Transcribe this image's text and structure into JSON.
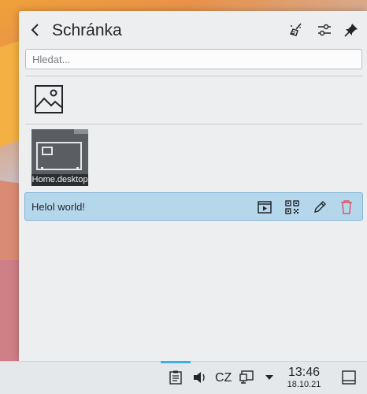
{
  "popup": {
    "title": "Schránka",
    "search_placeholder": "Hledat..."
  },
  "items": {
    "file_label": "Home.desktop",
    "text_value": "Helol world!"
  },
  "panel": {
    "keyboard_layout": "CZ",
    "time": "13:46",
    "date": "18.10.21"
  },
  "colors": {
    "selection": "#b5d7ec",
    "accent": "#3daee9",
    "delete": "#da4453"
  },
  "icons": [
    "back-icon",
    "clear-history-icon",
    "settings-icon",
    "pin-icon",
    "image-icon",
    "play-action-icon",
    "qr-code-icon",
    "edit-icon",
    "trash-icon",
    "clipboard-icon",
    "volume-icon",
    "network-icon",
    "arrow-up-icon",
    "show-desktop-icon"
  ]
}
